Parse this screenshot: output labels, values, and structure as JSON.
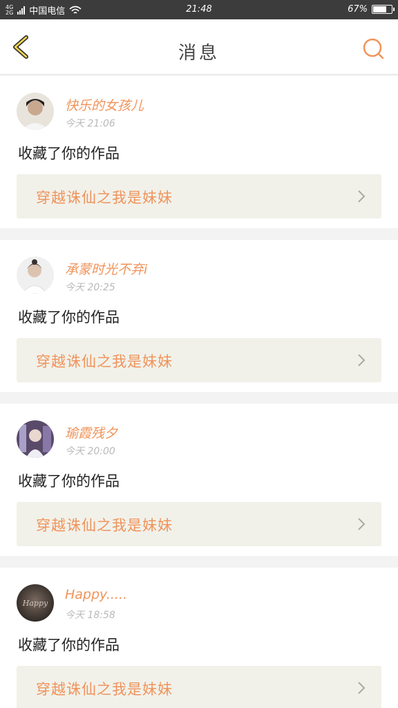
{
  "status_bar": {
    "network": [
      "4G",
      "2G"
    ],
    "carrier": "中国电信",
    "time": "21:48",
    "battery": "67%",
    "battery_level": 0.67
  },
  "header": {
    "title": "消息",
    "back_icon": "chevron-left-icon",
    "search_icon": "search-icon",
    "accent_color": "#f0935a"
  },
  "messages": [
    {
      "user": "快乐的女孩儿",
      "time": "今天 21:06",
      "action": "收藏了你的作品",
      "work_title": "穿越诛仙之我是妹妹"
    },
    {
      "user": "承蒙时光不弃i",
      "time": "今天 20:25",
      "action": "收藏了你的作品",
      "work_title": "穿越诛仙之我是妹妹"
    },
    {
      "user": "瑜霞残夕",
      "time": "今天 20:00",
      "action": "收藏了你的作品",
      "work_title": "穿越诛仙之我是妹妹"
    },
    {
      "user": "Happy.....",
      "time": "今天 18:58",
      "action": "收藏了你的作品",
      "work_title": "穿越诛仙之我是妹妹"
    }
  ]
}
